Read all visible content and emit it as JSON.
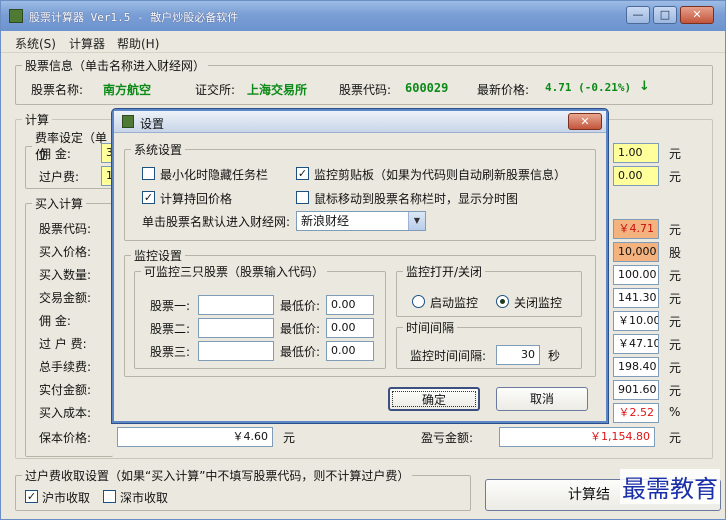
{
  "window": {
    "title": "股票计算器 Ver1.5 - 散户炒股必备软件",
    "min": "—",
    "max": "□",
    "close": "✕"
  },
  "menu": [
    "系统(S)",
    "计算器",
    "帮助(H)"
  ],
  "stock_info": {
    "legend": "股票信息（单击名称进入财经网）",
    "name_label": "股票名称:",
    "name": "南方航空",
    "exchange_label": "证交所:",
    "exchange": "上海交易所",
    "code_label": "股票代码:",
    "code": "600029",
    "price_label": "最新价格:",
    "price": "4.71 (-0.21%)",
    "colors": {
      "green": "#0c8a18",
      "red": "#e01515"
    }
  },
  "calc": {
    "legend": "计算",
    "fee_legend": "费率设定（单位",
    "commission_label": "佣  金:",
    "commission_value": "3.",
    "transfer_label": "过户费:",
    "transfer_value": "1.",
    "right_fee_1": "1.00",
    "right_fee_2": "0.00",
    "unit_yuan": "元"
  },
  "buy": {
    "legend": "买入计算",
    "labels": [
      "股票代码:",
      "买入价格:",
      "买入数量:",
      "交易金额:",
      "佣  金:",
      "过 户 费:",
      "总手续费:",
      "实付金额:",
      "买入成本:",
      "保本价格:"
    ],
    "right_values": [
      "￥4.71",
      "10,000",
      "100.00",
      "141.30",
      "￥10.00",
      "￥47.10",
      "198.40",
      "901.60",
      "￥2.52"
    ],
    "right_units": [
      "元",
      "股",
      "元",
      "元",
      "元",
      "元",
      "元",
      "元",
      "%"
    ],
    "breakeven_value": "￥4.60",
    "breakeven_unit": "元",
    "profit_label": "盈亏金额:",
    "profit_value": "￥1,154.80",
    "profit_unit": "元"
  },
  "transfer_fee": {
    "legend": "过户费收取设置（如果“买入计算”中不填写股票代码，则不计算过户费）",
    "sh": "沪市收取",
    "sz": "深市收取",
    "calc_button": "计算结"
  },
  "dialog": {
    "title": "设置",
    "close": "✕",
    "system_legend": "系统设置",
    "opt_minimize": "最小化时隐藏任务栏",
    "opt_clipboard": "监控剪贴板（如果为代码则自动刷新股票信息）",
    "opt_hold_price": "计算持回价格",
    "opt_mouse": "鼠标移动到股票名称栏时，显示分时图",
    "site_label": "单击股票名默认进入财经网:",
    "site_value": "新浪财经",
    "monitor_legend": "监控设置",
    "three_legend": "可监控三只股票（股票输入代码）",
    "stock_labels": [
      "股票一:",
      "股票二:",
      "股票三:"
    ],
    "min_price_label": "最低价:",
    "min_prices": [
      "0.00",
      "0.00",
      "0.00"
    ],
    "toggle_legend": "监控打开/关闭",
    "start_label": "启动监控",
    "stop_label": "关闭监控",
    "interval_legend": "时间间隔",
    "interval_label": "监控时间间隔:",
    "interval_value": "30",
    "interval_unit": "秒",
    "ok": "确定",
    "cancel": "取消"
  },
  "watermark": "最需教育"
}
